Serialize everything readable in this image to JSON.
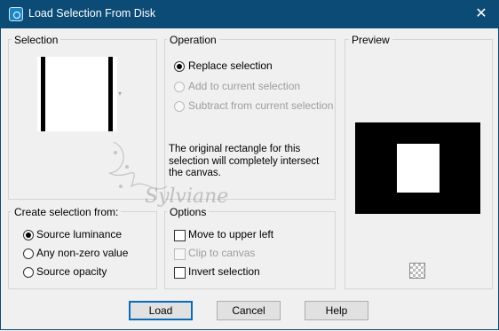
{
  "window": {
    "title": "Load Selection From Disk",
    "close_glyph": "✕"
  },
  "selection_group": {
    "label": "Selection"
  },
  "operation": {
    "label": "Operation",
    "options": [
      {
        "label": "Replace selection",
        "checked": true,
        "enabled": true
      },
      {
        "label": "Add to current selection",
        "checked": false,
        "enabled": false
      },
      {
        "label": "Subtract from current selection",
        "checked": false,
        "enabled": false
      }
    ],
    "note_lines": [
      "The original rectangle for this",
      "selection will completely intersect",
      "the canvas."
    ]
  },
  "preview": {
    "label": "Preview",
    "checker_icon": "transparency-checker-icon"
  },
  "create_from": {
    "label": "Create selection from:",
    "options": [
      {
        "label": "Source luminance",
        "checked": true
      },
      {
        "label": "Any non-zero value",
        "checked": false
      },
      {
        "label": "Source opacity",
        "checked": false
      }
    ]
  },
  "options": {
    "label": "Options",
    "items": [
      {
        "label": "Move to upper left",
        "checked": false,
        "enabled": true
      },
      {
        "label": "Clip to canvas",
        "checked": false,
        "enabled": false
      },
      {
        "label": "Invert selection",
        "checked": false,
        "enabled": true
      }
    ]
  },
  "watermark": {
    "text": "Sylviane"
  },
  "buttons": {
    "load": "Load",
    "cancel": "Cancel",
    "help": "Help"
  },
  "colors": {
    "titlebar": "#0b4b76",
    "dialog_bg": "#f0f0f0",
    "default_button_border": "#0b6bb8"
  }
}
